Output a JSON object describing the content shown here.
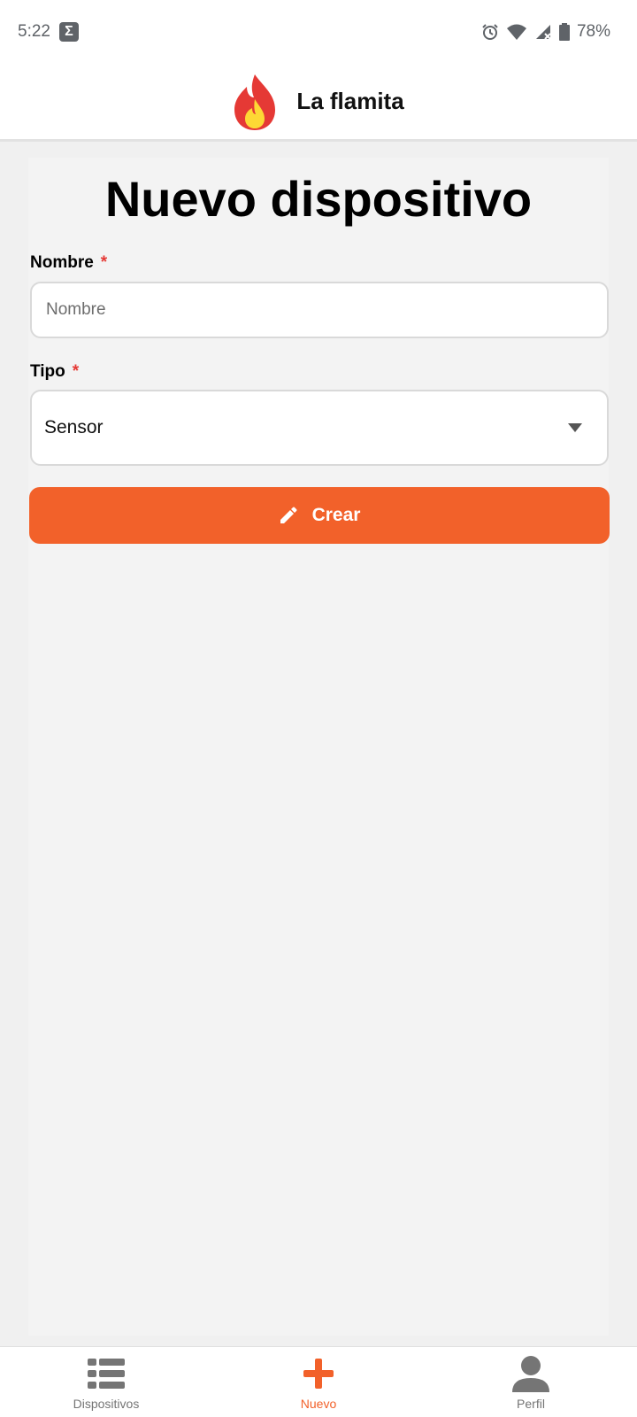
{
  "status_bar": {
    "time": "5:22",
    "notification_icon": "sigma-icon",
    "battery": "78%",
    "icons": [
      "alarm-icon",
      "wifi-icon",
      "signal-icon",
      "battery-icon"
    ]
  },
  "header": {
    "title": "La flamita",
    "logo_icon": "flame-icon"
  },
  "form": {
    "title": "Nuevo dispositivo",
    "name_label": "Nombre",
    "name_required": "*",
    "name_placeholder": "Nombre",
    "name_value": "",
    "type_label": "Tipo",
    "type_required": "*",
    "type_selected": "Sensor",
    "submit_label": "Crear",
    "submit_icon": "pencil-icon"
  },
  "nav": {
    "items": [
      {
        "label": "Dispositivos",
        "icon": "list-icon",
        "active": false
      },
      {
        "label": "Nuevo",
        "icon": "plus-icon",
        "active": true
      },
      {
        "label": "Perfil",
        "icon": "user-icon",
        "active": false
      }
    ]
  },
  "colors": {
    "accent": "#f2612a",
    "required": "#e53935",
    "inactive": "#757575"
  }
}
